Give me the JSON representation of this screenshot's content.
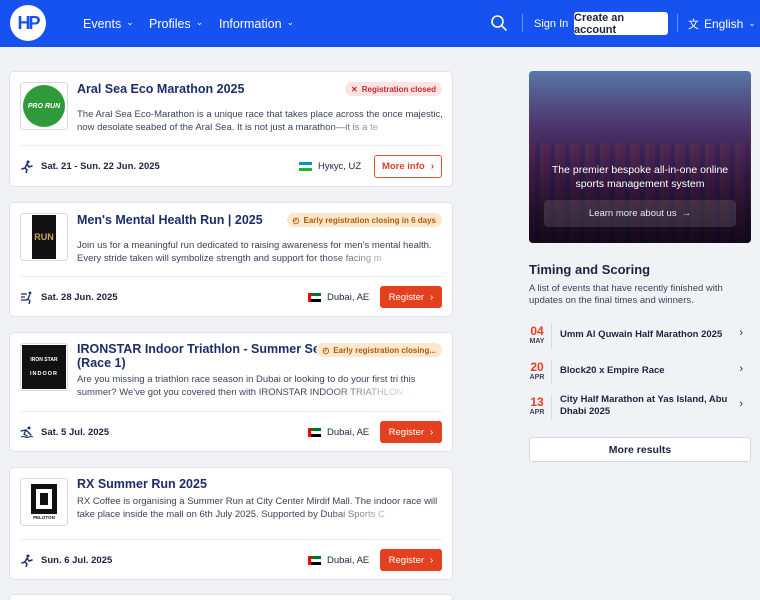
{
  "header": {
    "logo_text": "HP",
    "nav": [
      "Events",
      "Profiles",
      "Information"
    ],
    "sign_in": "Sign In",
    "create_account": "Create an account",
    "language": "English"
  },
  "events": [
    {
      "title": "Aral Sea Eco Marathon 2025",
      "badge": "Registration closed",
      "badge_type": "closed",
      "description": "The Aral Sea Eco-Marathon is a unique race that takes place across the once majestic, now desolate seabed of the Aral Sea. It is not just a marathon—it is a te",
      "thumb_text": "PRO RUN",
      "date": "Sat. 21 - Sun. 22 Jun. 2025",
      "location": "Нукус, UZ",
      "action": "More info"
    },
    {
      "title": "Men's Mental Health Run | 2025",
      "badge": "Early registration closing in 6 days",
      "badge_type": "early",
      "description": "Join us for a meaningful run dedicated to raising awareness for men's mental health. Every stride taken will symbolize strength and support for those facing m",
      "thumb_text": "RUN",
      "date": "Sat. 28 Jun. 2025",
      "location": "Dubai, AE",
      "action": "Register"
    },
    {
      "title_line1": "IRONSTAR Indoor Triathlon - Summer Series",
      "title_line2": "(Race 1)",
      "badge": "Early registration closing...",
      "badge_type": "early",
      "description": "Are you missing a triathlon race season in Dubai or looking to do your first tri this summer? We've got you covered then with IRONSTAR INDOOR TRIATHLON -",
      "thumb_text_1": "IRON STAR",
      "thumb_text_2": "INDOOR",
      "date": "Sat. 5 Jul. 2025",
      "location": "Dubai, AE",
      "action": "Register"
    },
    {
      "title": "RX Summer Run 2025",
      "description": "RX Coffee is organising a Summer Run at City Center Mirdif Mall. The indoor race will take place inside the mall on 6th July 2025. Supported by Dubai Sports C",
      "thumb_text": "PELOTON",
      "date": "Sun. 6 Jul. 2025",
      "location": "Dubai, AE",
      "action": "Register"
    }
  ],
  "promo": {
    "text": "The premier bespoke all-in-one online sports management system",
    "button": "Learn more about us"
  },
  "timing": {
    "title": "Timing and Scoring",
    "subtitle": "A list of events that have recently finished with updates on the final times and winners.",
    "results": [
      {
        "day": "04",
        "month": "MAY",
        "name": "Umm Al Quwain Half Marathon 2025"
      },
      {
        "day": "20",
        "month": "APR",
        "name": "Block20 x Empire Race"
      },
      {
        "day": "13",
        "month": "APR",
        "name": "City Half Marathon at Yas Island, Abu Dhabi 2025"
      }
    ],
    "more": "More results"
  },
  "colors": {
    "brand_blue": "#1652f0",
    "accent_red": "#e4401f",
    "title_navy": "#1b2e6b"
  }
}
